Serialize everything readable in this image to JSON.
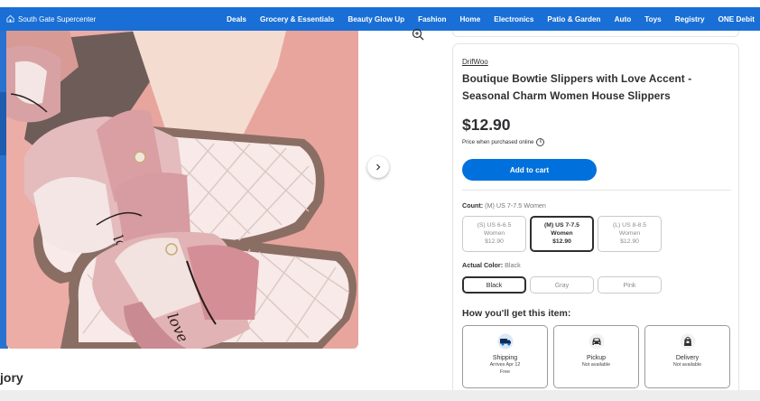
{
  "header": {
    "store": "South Gate Supercenter",
    "nav": [
      "Deals",
      "Grocery & Essentials",
      "Beauty Glow Up",
      "Fashion",
      "Home",
      "Electronics",
      "Patio & Garden",
      "Auto",
      "Toys",
      "Registry",
      "ONE Debit"
    ]
  },
  "gallery": {
    "image_alt": "pink bowtie slippers with love lettering",
    "bow_text": "love",
    "section_heading_partial": "jory"
  },
  "product": {
    "brand": "DrifWoo",
    "title": "Boutique Bowtie Slippers with Love Accent - Seasonal Charm Women House Slippers",
    "price": "$12.90",
    "price_note": "Price when purchased online",
    "add_to_cart": "Add to cart"
  },
  "options": {
    "count_label": "Count:",
    "count_value": "(M) US 7-7.5 Women",
    "sizes": [
      {
        "line1": "(S) US 6-6.5",
        "line2": "Women",
        "price": "$12.90"
      },
      {
        "line1": "(M) US 7-7.5",
        "line2": "Women",
        "price": "$12.90"
      },
      {
        "line1": "(L) US 8-8.5",
        "line2": "Women",
        "price": "$12.90"
      }
    ],
    "color_label": "Actual Color:",
    "color_value": "Black",
    "colors": [
      "Black",
      "Gray",
      "Pink"
    ]
  },
  "fulfillment": {
    "heading": "How you'll get this item:",
    "shipping": {
      "name": "Shipping",
      "line1": "Arrives Apr 12",
      "line2": "Free"
    },
    "pickup": {
      "name": "Pickup",
      "line1": "Not available"
    },
    "delivery": {
      "name": "Delivery",
      "line1": "Not available"
    }
  },
  "colors": {
    "brand_blue": "#0071dc",
    "nav_blue": "#1a6fd6",
    "text": "#2e2f32",
    "photo_pink": "#e9a9a1"
  }
}
